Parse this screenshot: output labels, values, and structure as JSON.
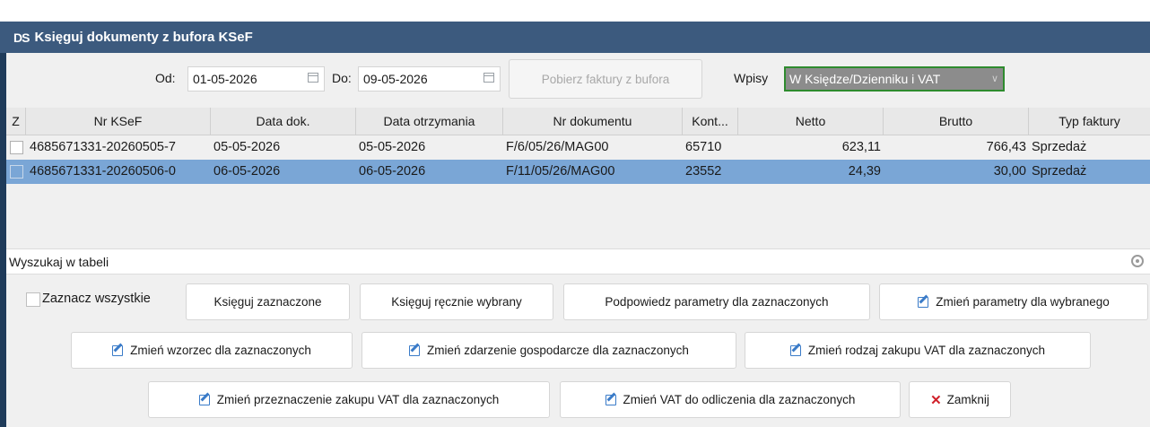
{
  "app": {
    "logo": "DS",
    "title": "Księguj dokumenty z bufora KSeF"
  },
  "filters": {
    "from_label": "Od:",
    "from_value": "01-05-2026",
    "to_label": "Do:",
    "to_value": "09-05-2026",
    "fetch_button": "Pobierz faktury z bufora",
    "wpisy_label": "Wpisy",
    "wpisy_value": "W Księdze/Dzienniku i VAT"
  },
  "table": {
    "columns": [
      "Z",
      "Nr KSeF",
      "Data dok.",
      "Data otrzymania",
      "Nr dokumentu",
      "Kont...",
      "Netto",
      "Brutto",
      "Typ faktury"
    ],
    "rows": [
      {
        "nr_ksef": "4685671331-20260505-7",
        "data_dok": "05-05-2026",
        "data_otrz": "05-05-2026",
        "nr_dok": "F/6/05/26/MAG00",
        "kont": "65710",
        "netto": "623,11",
        "brutto": "766,43",
        "typ": "Sprzedaż",
        "selected": false
      },
      {
        "nr_ksef": "4685671331-20260506-0",
        "data_dok": "06-05-2026",
        "data_otrz": "06-05-2026",
        "nr_dok": "F/11/05/26/MAG00",
        "kont": "23552",
        "netto": "24,39",
        "brutto": "30,00",
        "typ": "Sprzedaż",
        "selected": true
      }
    ]
  },
  "search": {
    "label": "Wyszukaj w tabeli"
  },
  "actions": {
    "select_all": "Zaznacz wszystkie",
    "post_selected": "Księguj zaznaczone",
    "post_manual": "Księguj ręcznie wybrany",
    "suggest_params": "Podpowiedz parametry dla zaznaczonych",
    "change_params": "Zmień parametry dla wybranego",
    "change_pattern": "Zmień wzorzec dla zaznaczonych",
    "change_event": "Zmień zdarzenie gospodarcze dla zaznaczonych",
    "change_purchase_type": "Zmień rodzaj zakupu VAT dla zaznaczonych",
    "change_purchase_purpose": "Zmień przeznaczenie zakupu VAT dla zaznaczonych",
    "change_vat_deduct": "Zmień VAT do odliczenia dla zaznaczonych",
    "close": "Zamknij"
  },
  "colors": {
    "titlebar": "#3c5a7e",
    "selected_row": "#7aa6d6",
    "select_border": "#2e8b2e",
    "edit_icon": "#3a7bc8",
    "close_icon": "#d0202a"
  }
}
